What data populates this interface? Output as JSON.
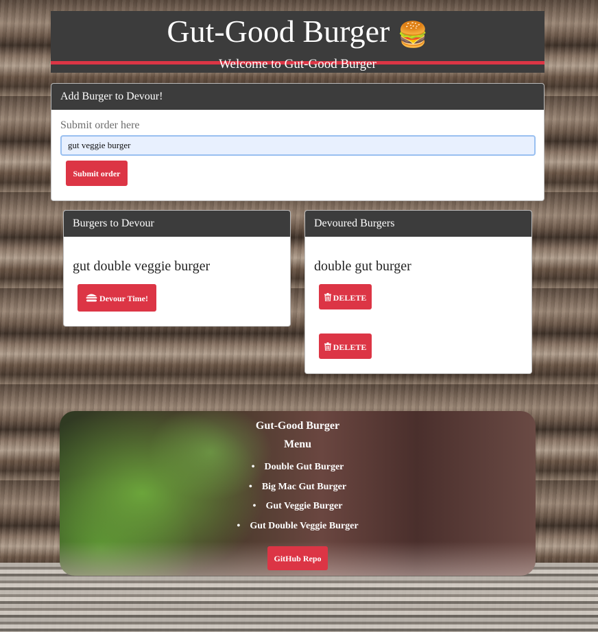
{
  "header": {
    "title": "Gut-Good Burger",
    "title_icon": "🍔",
    "subtitle": "Welcome to Gut-Good Burger",
    "accent_color": "#dc3545",
    "bar_color": "#3c3c3c"
  },
  "add_form": {
    "header": "Add Burger to Devour!",
    "label": "Submit order here",
    "input_value": "gut veggie burger",
    "submit_label": "Submit order"
  },
  "to_devour": {
    "header": "Burgers to Devour",
    "items": [
      {
        "name": "gut double veggie burger",
        "button_label": "Devour Time!",
        "button_icon": "hamburger-icon"
      }
    ]
  },
  "devoured": {
    "header": "Devoured Burgers",
    "items": [
      {
        "name": "double gut burger",
        "button_label": "DELETE",
        "button_icon": "trash-icon"
      },
      {
        "name": "",
        "button_label": "DELETE",
        "button_icon": "trash-icon"
      }
    ]
  },
  "footer": {
    "title": "Gut-Good Burger",
    "menu_heading": "Menu",
    "menu_items": [
      "Double Gut Burger",
      "Big Mac Gut Burger",
      "Gut Veggie Burger",
      "Gut Double Veggie Burger"
    ],
    "repo_label": "GitHub Repo"
  }
}
